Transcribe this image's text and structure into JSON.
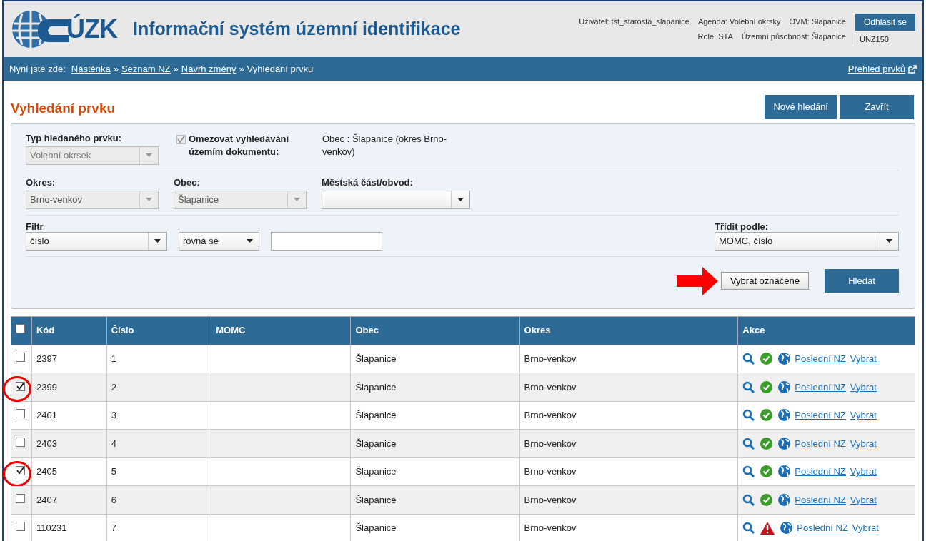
{
  "header": {
    "logo_text": "ÚZK",
    "app_title": "Informační systém územní identifikace",
    "user_line_1": [
      "Uživatel: tst_starosta_slapanice",
      "Agenda: Volební okrsky",
      "OVM: Slapanice"
    ],
    "user_line_2": [
      "Role: STA",
      "Územní působnost: Šlapanice"
    ],
    "logout": "Odhlásit se",
    "code": "UNZ150"
  },
  "breadcrumb": {
    "prefix": "Nyní jste zde:",
    "items": [
      {
        "label": "Nástěnka",
        "link": true
      },
      {
        "label": "Seznam NZ",
        "link": true
      },
      {
        "label": "Návrh změny",
        "link": true
      },
      {
        "label": "Vyhledání prvku",
        "link": false
      }
    ],
    "separator": "»",
    "right_link": "Přehled prvků"
  },
  "page_title": "Vyhledání prvku",
  "top_buttons": [
    {
      "label": "Nové hledání"
    },
    {
      "label": "Zavřít"
    }
  ],
  "filter": {
    "type_field": {
      "label": "Typ hledaného prvku:",
      "value": "Volební okrsek",
      "disabled": true
    },
    "restrict": {
      "label": "Omezovat vyhledávání územím dokumentu:",
      "checked": true,
      "disabled": true
    },
    "area_text": "Obec : Šlapanice (okres Brno-venkov)",
    "okres": {
      "label": "Okres:",
      "value": "Brno-venkov",
      "disabled": true
    },
    "obec": {
      "label": "Obec:",
      "value": "Šlapanice",
      "disabled": true
    },
    "mestska_cast": {
      "label": "Městská část/obvod:",
      "disabled": false
    },
    "filtr_label": "Filtr",
    "filtr_field": {
      "value": "číslo",
      "disabled": false
    },
    "operator_field": {
      "value": "rovná se",
      "disabled": false
    },
    "sort": {
      "label": "Třídit podle:",
      "value": "MOMC, číslo",
      "disabled": false
    },
    "select_marked": {
      "label": "Vybrat označené",
      "arrow": true
    },
    "search_button": "Hledat"
  },
  "table": {
    "columns": [
      "Kód",
      "Číslo",
      "MOMC",
      "Obec",
      "Okres",
      "Akce"
    ],
    "header_checked": false,
    "rows": [
      {
        "kod": "2397",
        "cislo": "1",
        "obec": "Šlapanice",
        "okres": "Brno-venkov",
        "checked": false,
        "circled": false,
        "warning": false,
        "link_1": "Poslední NZ",
        "link_2": "Vybrat"
      },
      {
        "kod": "2399",
        "cislo": "2",
        "obec": "Šlapanice",
        "okres": "Brno-venkov",
        "checked": true,
        "circled": true,
        "warning": false,
        "link_1": "Poslední NZ",
        "link_2": "Vybrat"
      },
      {
        "kod": "2401",
        "cislo": "3",
        "obec": "Šlapanice",
        "okres": "Brno-venkov",
        "checked": false,
        "circled": false,
        "warning": false,
        "link_1": "Poslední NZ",
        "link_2": "Vybrat"
      },
      {
        "kod": "2403",
        "cislo": "4",
        "obec": "Šlapanice",
        "okres": "Brno-venkov",
        "checked": false,
        "circled": false,
        "warning": false,
        "link_1": "Poslední NZ",
        "link_2": "Vybrat"
      },
      {
        "kod": "2405",
        "cislo": "5",
        "obec": "Šlapanice",
        "okres": "Brno-venkov",
        "checked": true,
        "circled": true,
        "warning": false,
        "link_1": "Poslední NZ",
        "link_2": "Vybrat"
      },
      {
        "kod": "2407",
        "cislo": "6",
        "obec": "Šlapanice",
        "okres": "Brno-venkov",
        "checked": false,
        "circled": false,
        "warning": false,
        "link_1": "Poslední NZ",
        "link_2": "Vybrat"
      },
      {
        "kod": "110231",
        "cislo": "7",
        "obec": "Šlapanice",
        "okres": "Brno-venkov",
        "checked": false,
        "circled": false,
        "warning": true,
        "link_1": "Poslední NZ",
        "link_2": "Vybrat"
      }
    ]
  }
}
